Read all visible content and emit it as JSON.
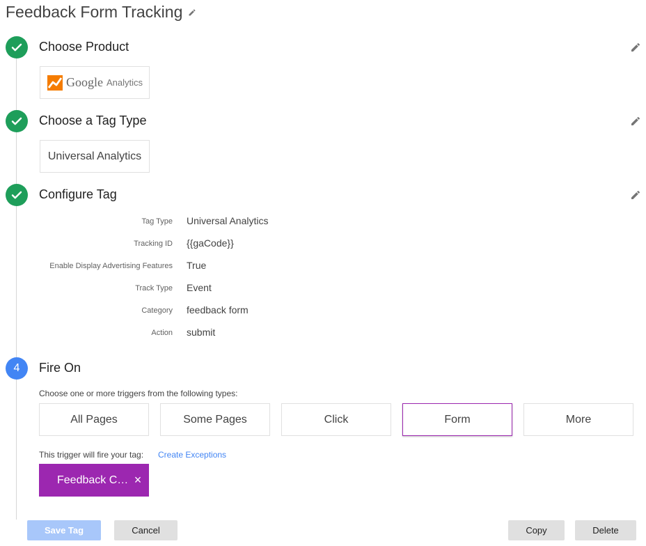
{
  "header": {
    "title": "Feedback Form Tracking",
    "title_edit_icon": "pencil-icon"
  },
  "steps": [
    {
      "status": "done",
      "title": "Choose Product",
      "card": {
        "logo_brand": "Google",
        "logo_product": "Analytics"
      }
    },
    {
      "status": "done",
      "title": "Choose a Tag Type",
      "card": {
        "label": "Universal Analytics"
      }
    },
    {
      "status": "done",
      "title": "Configure Tag",
      "config": [
        {
          "label": "Tag Type",
          "value": "Universal Analytics"
        },
        {
          "label": "Tracking ID",
          "value": "{{gaCode}}"
        },
        {
          "label": "Enable Display Advertising Features",
          "value": "True"
        },
        {
          "label": "Track Type",
          "value": "Event"
        },
        {
          "label": "Category",
          "value": "feedback form"
        },
        {
          "label": "Action",
          "value": "submit"
        }
      ]
    },
    {
      "status": "active",
      "number": "4",
      "title": "Fire On"
    }
  ],
  "fire_on": {
    "hint": "Choose one or more triggers from the following types:",
    "trigger_types": [
      "All Pages",
      "Some Pages",
      "Click",
      "Form",
      "More"
    ],
    "selected_trigger": "Form",
    "fire_text": "This trigger will fire your tag:",
    "exceptions_link": "Create Exceptions",
    "chip_label": "Feedback C…",
    "chip_close": "×"
  },
  "footer": {
    "save": "Save Tag",
    "cancel": "Cancel",
    "copy": "Copy",
    "delete": "Delete"
  },
  "colors": {
    "done": "#1e9e5a",
    "active": "#4285f4",
    "accent": "#9c27b0",
    "link": "#4285f4",
    "primary_disabled": "#a8c7fa"
  }
}
